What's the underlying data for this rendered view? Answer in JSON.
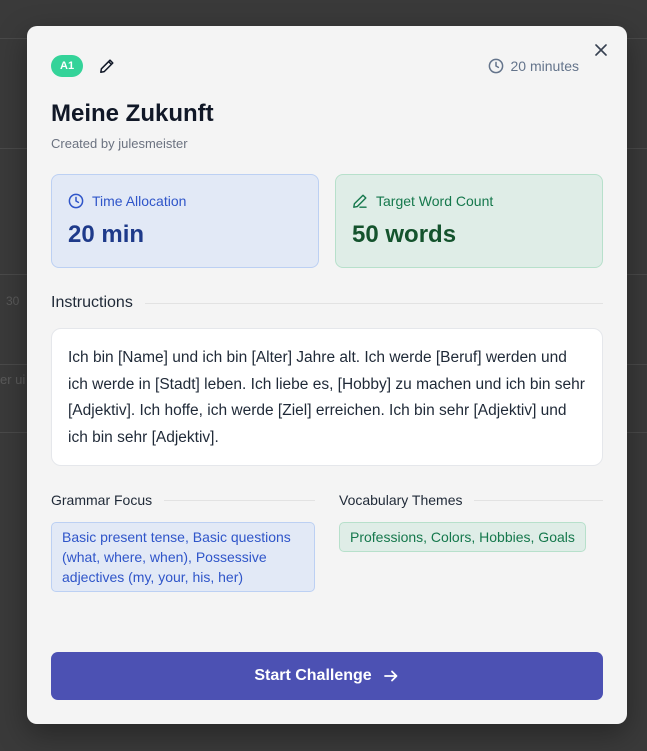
{
  "background": {
    "fragment_1": "30",
    "fragment_2": "er ui"
  },
  "modal": {
    "level_badge": "A1",
    "duration": "20 minutes",
    "title": "Meine Zukunft",
    "creator": "Created by julesmeister",
    "time_allocation": {
      "label": "Time Allocation",
      "value": "20 min"
    },
    "target_word_count": {
      "label": "Target Word Count",
      "value": "50 words"
    },
    "instructions": {
      "heading": "Instructions",
      "text": "Ich bin [Name] und ich bin [Alter] Jahre alt. Ich werde [Beruf] werden und ich werde in [Stadt] leben. Ich liebe es, [Hobby] zu machen und ich bin sehr [Adjektiv]. Ich hoffe, ich werde [Ziel] erreichen. Ich bin sehr [Adjektiv] und ich bin sehr [Adjektiv]."
    },
    "grammar_focus": {
      "heading": "Grammar Focus",
      "tag": "Basic present tense, Basic questions (what, where, when), Possessive adjectives (my, your, his, her)"
    },
    "vocabulary_themes": {
      "heading": "Vocabulary Themes",
      "tag": "Professions, Colors, Hobbies, Goals"
    },
    "start_button": "Start Challenge"
  },
  "icons": {
    "close": "close-icon",
    "edit": "pencil-icon",
    "clock": "clock-icon",
    "arrow": "arrow-right-icon"
  },
  "colors": {
    "accent": "#4c51b3",
    "badge": "#34d399",
    "blue_text": "#2f55c9",
    "green_text": "#15784c"
  }
}
